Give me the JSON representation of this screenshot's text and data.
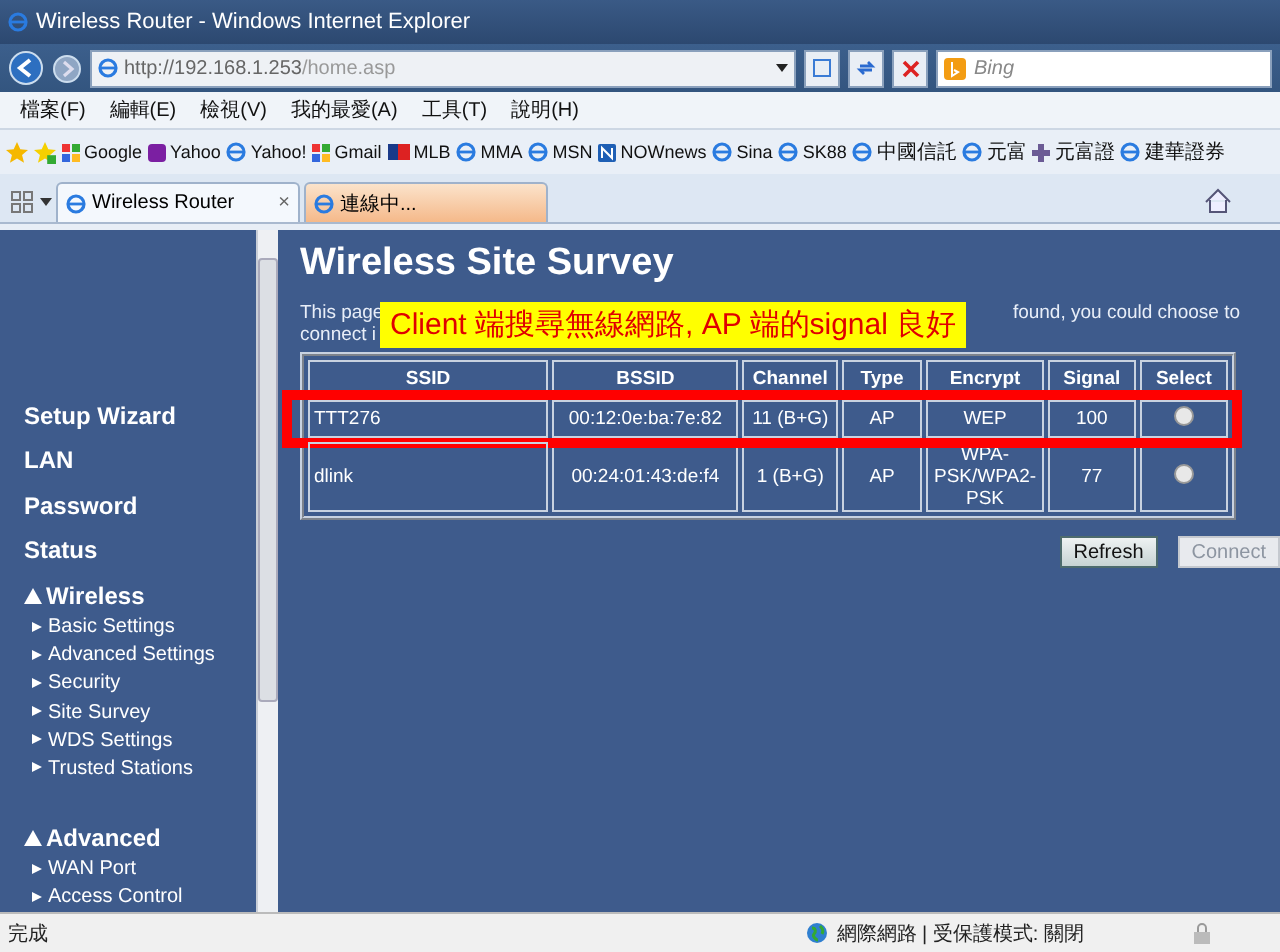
{
  "window": {
    "title": "Wireless Router - Windows Internet Explorer"
  },
  "address_bar": {
    "url_host": "http://192.168.1.253",
    "url_path": "/home.asp",
    "search_placeholder": "Bing"
  },
  "menu": [
    "檔案(F)",
    "編輯(E)",
    "檢視(V)",
    "我的最愛(A)",
    "工具(T)",
    "說明(H)"
  ],
  "favorites": [
    {
      "label": "Google",
      "kind": "google"
    },
    {
      "label": "Yahoo",
      "kind": "yahoo"
    },
    {
      "label": "Yahoo!",
      "kind": "ie"
    },
    {
      "label": "Gmail",
      "kind": "google"
    },
    {
      "label": "MLB",
      "kind": "mlb"
    },
    {
      "label": "MMA",
      "kind": "ie"
    },
    {
      "label": "MSN",
      "kind": "ie"
    },
    {
      "label": "NOWnews",
      "kind": "news"
    },
    {
      "label": "Sina",
      "kind": "ie"
    },
    {
      "label": "SK88",
      "kind": "ie"
    },
    {
      "label": "中國信託",
      "kind": "ie"
    },
    {
      "label": "元富",
      "kind": "ie"
    },
    {
      "label": "元富證",
      "kind": "cross"
    },
    {
      "label": "建華證券",
      "kind": "ie"
    }
  ],
  "tabs": [
    {
      "label": "Wireless Router",
      "selected": true,
      "close": "×"
    },
    {
      "label": "連線中...",
      "selected": false
    }
  ],
  "sidebar": {
    "items": [
      {
        "label": "Setup Wizard"
      },
      {
        "label": "LAN"
      },
      {
        "label": "Password"
      },
      {
        "label": "Status"
      },
      {
        "label": "Wireless",
        "expanded": true,
        "children": [
          {
            "label": "Basic Settings"
          },
          {
            "label": "Advanced Settings"
          },
          {
            "label": "Security"
          },
          {
            "label": "Site Survey"
          },
          {
            "label": "WDS Settings"
          },
          {
            "label": "Trusted Stations"
          }
        ]
      },
      {
        "label": "Advanced",
        "expanded": true,
        "children": [
          {
            "label": "WAN Port"
          },
          {
            "label": "Access Control"
          }
        ]
      }
    ]
  },
  "page": {
    "title": "Wireless Site Survey",
    "description_visible": [
      "This page",
      "found, you could choose to",
      "connect i"
    ]
  },
  "annotation": {
    "text": "Client 端搜尋無線網路, AP 端的signal 良好"
  },
  "table": {
    "columns": [
      "SSID",
      "BSSID",
      "Channel",
      "Type",
      "Encrypt",
      "Signal",
      "Select"
    ],
    "rows": [
      {
        "ssid": "TTT276",
        "bssid": "00:12:0e:ba:7e:82",
        "channel": "11 (B+G)",
        "type": "AP",
        "encrypt": "WEP",
        "signal": "100",
        "selected": false,
        "highlighted": true
      },
      {
        "ssid": "dlink",
        "bssid": "00:24:01:43:de:f4",
        "channel": "1 (B+G)",
        "type": "AP",
        "encrypt": "WPA-PSK/WPA2-PSK",
        "signal": "77",
        "selected": false,
        "highlighted": false
      }
    ]
  },
  "buttons": [
    {
      "label": "Refresh",
      "disabled": false
    },
    {
      "label": "Connect",
      "disabled": true
    }
  ],
  "status_bar": {
    "left": "完成",
    "zone": "網際網路 | 受保護模式: 關閉"
  }
}
